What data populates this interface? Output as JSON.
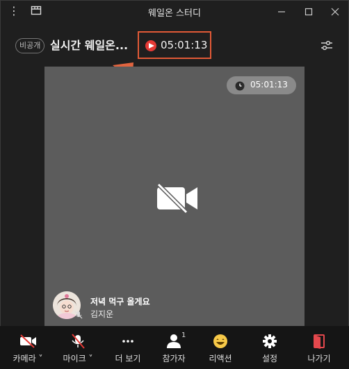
{
  "window": {
    "title": "웨일온 스터디"
  },
  "header": {
    "private_badge": "비공개",
    "room_title": "실시간 웨일온...",
    "live_timer": "05:01:13"
  },
  "video": {
    "timer": "05:01:13",
    "participant_message": "저녁 먹구 올게요",
    "participant_name": "김지운"
  },
  "toolbar": {
    "camera": "카메라 ˅",
    "mic": "마이크 ˅",
    "more": "더 보기",
    "participants": "참가자",
    "participant_count": "1",
    "reaction": "리액션",
    "settings": "설정",
    "leave": "나가기"
  },
  "colors": {
    "accent_orange": "#e25a37",
    "leave_red": "#e5484d",
    "video_bg": "#5c5c5c"
  }
}
